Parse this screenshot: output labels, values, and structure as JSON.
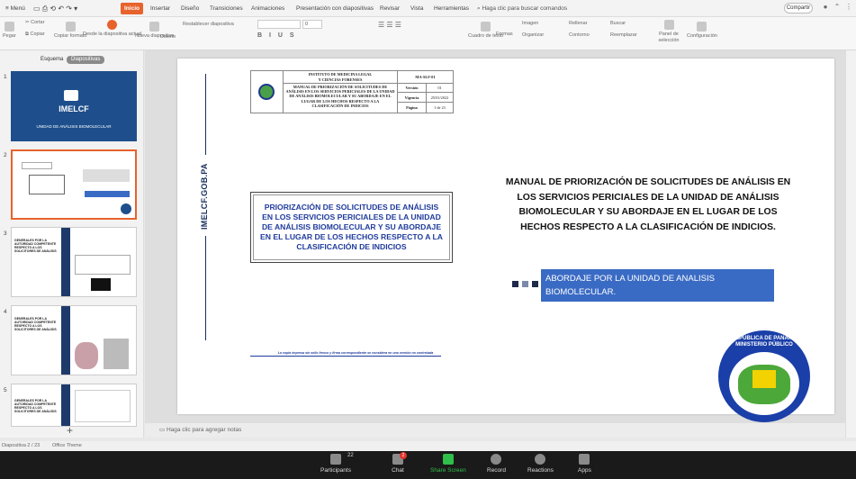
{
  "menubar": {
    "menu_label": "Menú",
    "tabs": [
      "Inicio",
      "Insertar",
      "Diseño",
      "Transiciones",
      "Animaciones",
      "Presentación con diapositivas",
      "Revisar",
      "Vista",
      "Herramientas"
    ],
    "search": "Haga clic para buscar comandos",
    "share": "Compartir"
  },
  "ribbon": {
    "page": "Pegar",
    "cut": "Cortar",
    "copy": "Copiar",
    "format_painter": "Copiar formato",
    "from_current": "Desde la diapositiva actual",
    "new_slide": "Nueva diapositiva",
    "design": "Diseño",
    "reset": "Restablecer diapositiva",
    "font_size": "0",
    "text_box": "Cuadro de texto",
    "shapes": "Formas",
    "image": "Imagen",
    "arrange": "Organizar",
    "fill": "Rellenar",
    "outline": "Contorno",
    "find": "Buscar",
    "replace": "Reemplazar",
    "select": "Seleccionar",
    "selection_pane": "Panel de selección",
    "config": "Configuración"
  },
  "leftpanel": {
    "tab_outline": "Esquema",
    "tab_slides": "Diapositivas",
    "thumbs": [
      {
        "num": "1",
        "title": "IMELCF",
        "subtitle": "UNIDAD DE ANÁLISIS BIOMOLECULAR"
      },
      {
        "num": "2"
      },
      {
        "num": "3",
        "heading": "GENERALES POR LA AUTORIDAD COMPETENTE RESPECTO A LOS SOLICITORES DE ANÁLISIS"
      },
      {
        "num": "4",
        "heading": "GENERALES POR LA AUTORIDAD COMPETENTE RESPECTO A LOS SOLICITORES DE ANÁLISIS"
      },
      {
        "num": "5",
        "heading": "GENERALES POR LA AUTORIDAD COMPETENTE RESPECTO A LOS SOLICITORES DE ANÁLISIS"
      }
    ],
    "add": "+"
  },
  "slide": {
    "header": {
      "org1": "INSTITUTO DE MEDICINA LEGAL",
      "org2": "Y CIENCIAS FORENSES",
      "doc_title": "MANUAL DE PRIORIZACIÓN DE SOLICITUDES DE ANÁLISIS EN LOS SERVICIOS PERICIALES DE LA UNIDAD DE ANÁLISIS BIOMOLECULAR Y SU ABORDAJE EN EL LUGAR DE LOS HECHOS RESPECTO A LA CLASIFICACIÓN DE INDICIOS",
      "code": "MA-SLF-01",
      "version_label": "Versión",
      "version_value": "01",
      "vigencia_label": "Vigencia",
      "vigencia_value": "25/01/2022",
      "pagina_label": "Página",
      "pagina_value": "1 de 23"
    },
    "vertical_text": "IMELCF.GOB.PA",
    "box_text": "PRIORIZACIÓN DE SOLICITUDES DE ANÁLISIS EN LOS SERVICIOS PERICIALES DE LA UNIDAD DE ANÁLISIS BIOMOLECULAR Y SU ABORDAJE EN EL LUGAR DE LOS HECHOS RESPECTO A LA CLASIFICACIÓN DE INDICIOS",
    "footer_note": "La copia impresa sin sello fresco y firma correspondiente se considera en una versión no controlada",
    "main_title": "MANUAL DE PRIORIZACIÓN DE SOLICITUDES DE ANÁLISIS EN LOS SERVICIOS PERICIALES DE LA UNIDAD DE ANÁLISIS BIOMOLECULAR Y SU ABORDAJE EN EL LUGAR DE LOS HECHOS RESPECTO A LA CLASIFICACIÓN DE INDICIOS.",
    "blue_label": "ABORDAJE POR LA UNIDAD DE ANALISIS BIOMOLECULAR.",
    "seal_top1": "REPÚBLICA DE PANAMÁ",
    "seal_top2": "MINISTERIO PÚBLICO",
    "seal_ring": "INSTITUTO DE MEDICINA LEGAL Y CIENCIAS FORENSES"
  },
  "notes": "Haga clic para agregar notas",
  "status": {
    "slide_counter": "Diapositiva 2 / 23",
    "theme": "Office Theme"
  },
  "zoombar": {
    "participants_count": "22",
    "participants": "Participants",
    "chat": "Chat",
    "chat_badge": "2",
    "share": "Share Screen",
    "record": "Record",
    "reactions": "Reactions",
    "apps": "Apps"
  },
  "colors": {
    "accent": "#e8622c",
    "slide_blue": "#3a6bc4",
    "box_text": "#1f3b9c",
    "share_green": "#2fbf4a"
  }
}
